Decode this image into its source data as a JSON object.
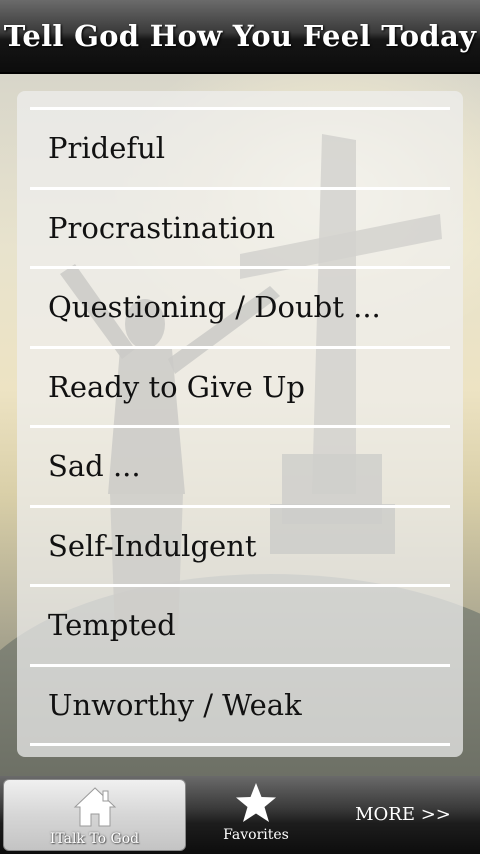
{
  "header": {
    "title": "Tell God How You Feel Today"
  },
  "feelings": {
    "items": [
      {
        "label": "Prideful"
      },
      {
        "label": "Procrastination"
      },
      {
        "label": "Questioning / Doubt ..."
      },
      {
        "label": "Ready to Give Up"
      },
      {
        "label": "Sad ..."
      },
      {
        "label": "Self-Indulgent"
      },
      {
        "label": "Tempted"
      },
      {
        "label": "Unworthy / Weak"
      }
    ]
  },
  "tabs": {
    "home": {
      "label": "ITalk To God",
      "icon": "house-icon"
    },
    "favorites": {
      "label": "Favorites",
      "icon": "star-icon"
    },
    "more": {
      "label": "MORE >>"
    }
  },
  "colors": {
    "title_bar": "#1a1a1a",
    "tab_bar": "#2a2a2a",
    "active_tab": "#d6d6d6",
    "list_text": "#111111",
    "divider": "#ffffff"
  }
}
